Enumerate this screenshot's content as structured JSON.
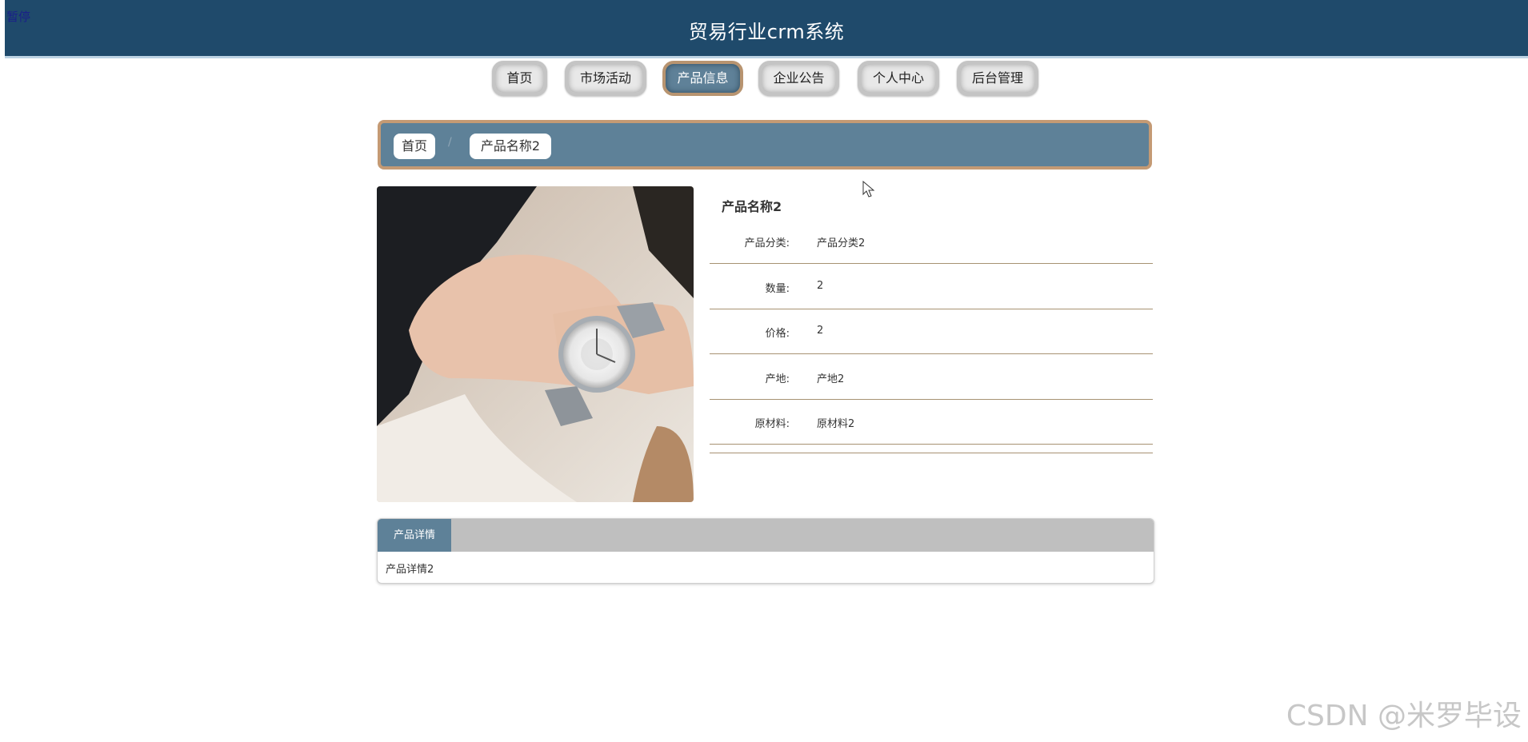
{
  "overlay": {
    "pause_label": "暂停"
  },
  "header": {
    "title": "贸易行业crm系统"
  },
  "nav": {
    "items": [
      {
        "label": "首页"
      },
      {
        "label": "市场活动"
      },
      {
        "label": "产品信息",
        "active": true
      },
      {
        "label": "企业公告"
      },
      {
        "label": "个人中心"
      },
      {
        "label": "后台管理"
      }
    ]
  },
  "breadcrumb": {
    "home": "首页",
    "separator": "/",
    "current": "产品名称2"
  },
  "product": {
    "name": "产品名称2",
    "fields": [
      {
        "label": "产品分类:",
        "value": "产品分类2"
      },
      {
        "label": "数量:",
        "value": "2"
      },
      {
        "label": "价格:",
        "value": "2"
      },
      {
        "label": "产地:",
        "value": "产地2"
      },
      {
        "label": "原材料:",
        "value": "原材料2"
      }
    ]
  },
  "detail": {
    "tab_label": "产品详情",
    "content": "产品详情2"
  },
  "watermark": "CSDN @米罗毕设",
  "colors": {
    "header_bg": "#1f4a6b",
    "accent": "#5e8198",
    "accent_border": "#c49a74",
    "divider": "#a79272"
  }
}
